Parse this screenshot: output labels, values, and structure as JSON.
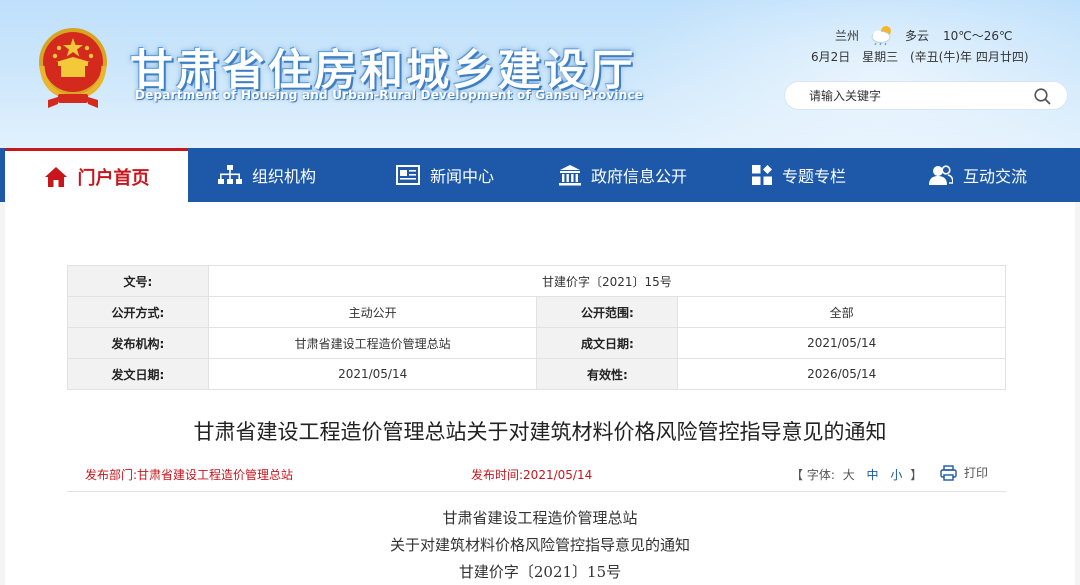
{
  "header": {
    "title": "甘肃省住房和城乡建设厅",
    "subtitle": "Department of Housing and Urban-Rural Development of Gansu Province",
    "weather": {
      "city": "兰州",
      "condition": "多云",
      "temperature": "10℃～26℃"
    },
    "date": {
      "day": "6月2日",
      "weekday": "星期三",
      "lunar": "(辛丑(牛)年 四月廿四)"
    },
    "search": {
      "placeholder": "请输入关键字"
    }
  },
  "nav": {
    "items": [
      {
        "label": "门户首页",
        "icon": "home-icon"
      },
      {
        "label": "组织机构",
        "icon": "org-chart-icon"
      },
      {
        "label": "新闻中心",
        "icon": "news-icon"
      },
      {
        "label": "政府信息公开",
        "icon": "government-building-icon"
      },
      {
        "label": "专题专栏",
        "icon": "grid-icon"
      },
      {
        "label": "互动交流",
        "icon": "users-icon"
      }
    ]
  },
  "meta": {
    "doc_no_label": "文号:",
    "doc_no": "甘建价字〔2021〕15号",
    "disclosure_label": "公开方式:",
    "disclosure": "主动公开",
    "scope_label": "公开范围:",
    "scope": "全部",
    "issuer_label": "发布机构:",
    "issuer": "甘肃省建设工程造价管理总站",
    "written_label": "成文日期:",
    "written": "2021/05/14",
    "issued_label": "发文日期:",
    "issued": "2021/05/14",
    "valid_label": "有效性:",
    "valid": "2026/05/14"
  },
  "article": {
    "title": "甘肃省建设工程造价管理总站关于对建筑材料价格风险管控指导意见的通知",
    "dept_label": "发布部门:",
    "dept": "甘肃省建设工程造价管理总站",
    "time_label": "发布时间:",
    "time": "2021/05/14",
    "fontsize_open": "【 字体:",
    "fontsize_large": "大",
    "fontsize_medium": "中",
    "fontsize_small": "小",
    "fontsize_close": "】",
    "print_label": "打印",
    "body_lines": [
      "甘肃省建设工程造价管理总站",
      "关于对建筑材料价格风险管控指导意见的通知",
      "甘建价字〔2021〕15号"
    ]
  },
  "colors": {
    "nav_bg": "#1d59a8",
    "accent_red": "#c8161d",
    "header_sky": "#cbe6fb"
  }
}
